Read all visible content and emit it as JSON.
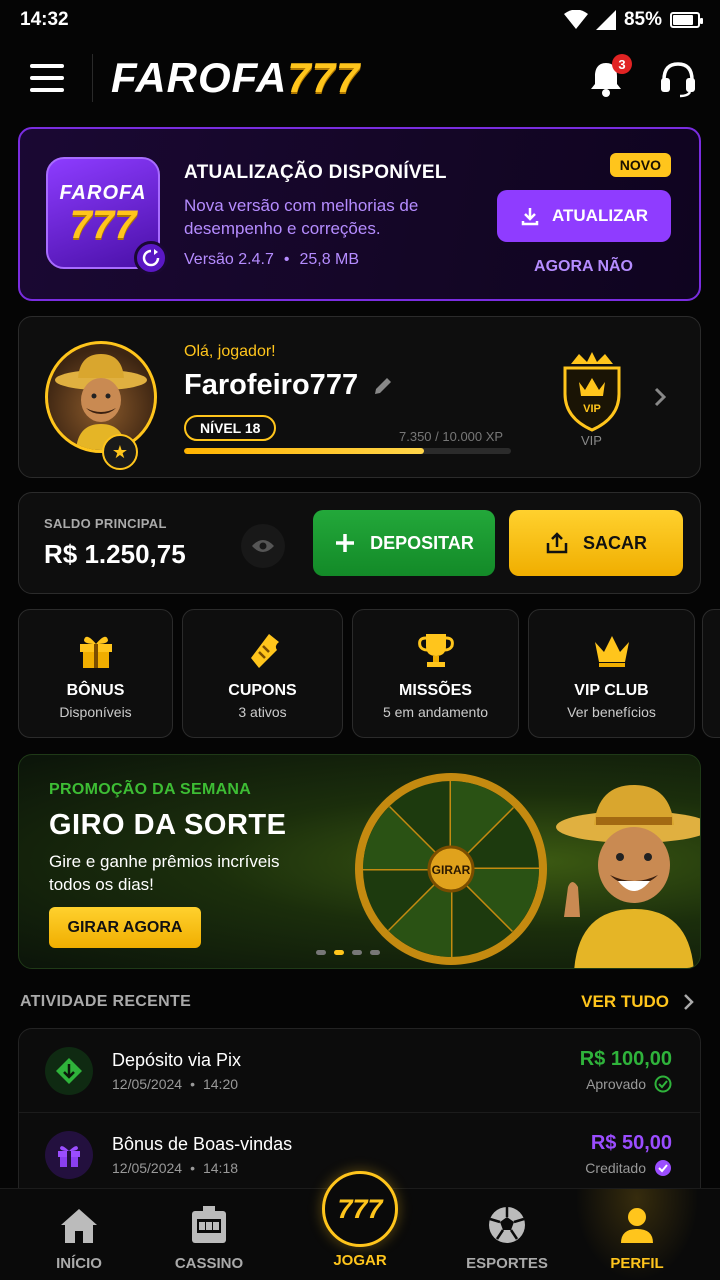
{
  "status_bar": {
    "time": "14:32",
    "battery": "85%",
    "battery_level": 0.85
  },
  "header": {
    "logo_word": "FAROFA",
    "logo_number": "777",
    "notification_count": "3"
  },
  "update": {
    "title": "ATUALIZAÇÃO DISPONÍVEL",
    "description": "Nova versão com melhorias de desempenho e correções.",
    "version": "Versão 2.4.7",
    "size": "25,8 MB",
    "badge": "NOVO",
    "button": "ATUALIZAR",
    "dismiss": "AGORA NÃO",
    "icon_line1": "FAROFA",
    "icon_line2": "777"
  },
  "profile": {
    "greeting": "Olá, jogador!",
    "username": "Farofeiro777",
    "level": "NÍVEL 18",
    "xp": "7.350 / 10.000 XP",
    "xp_progress": 0.735,
    "vip_label": "VIP",
    "vip_badge_text": "VIP"
  },
  "balance": {
    "label": "SALDO PRINCIPAL",
    "value": "R$ 1.250,75",
    "deposit": "DEPOSITAR",
    "withdraw": "SACAR"
  },
  "tiles": [
    {
      "title": "BÔNUS",
      "subtitle": "Disponíveis",
      "icon": "gift-icon"
    },
    {
      "title": "CUPONS",
      "subtitle": "3 ativos",
      "icon": "ticket-icon"
    },
    {
      "title": "MISSÕES",
      "subtitle": "5 em andamento",
      "icon": "trophy-icon"
    },
    {
      "title": "VIP CLUB",
      "subtitle": "Ver benefícios",
      "icon": "crown-icon"
    }
  ],
  "promo": {
    "kicker": "PROMOÇÃO DA SEMANA",
    "title": "GIRO DA SORTE",
    "description": "Gire e ganhe prêmios incríveis todos os dias!",
    "button": "GIRAR AGORA",
    "wheel_center": "GIRAR"
  },
  "activity": {
    "title": "ATIVIDADE RECENTE",
    "see_all": "VER TUDO",
    "items": [
      {
        "title": "Depósito via Pix",
        "date": "12/05/2024",
        "time": "14:20",
        "amount": "R$ 100,00",
        "status": "Aprovado",
        "color": "#2fb33b"
      },
      {
        "title": "Bônus de Boas-vindas",
        "date": "12/05/2024",
        "time": "14:18",
        "amount": "R$ 50,00",
        "status": "Creditado",
        "color": "#9b4dff"
      }
    ]
  },
  "nav": {
    "home": "INÍCIO",
    "casino": "CASSINO",
    "play_badge": "777",
    "play": "JOGAR",
    "sports": "ESPORTES",
    "profile": "PERFIL"
  },
  "colors": {
    "gold": "#ffc51c",
    "purple": "#8f3cff",
    "green": "#23a83a"
  }
}
